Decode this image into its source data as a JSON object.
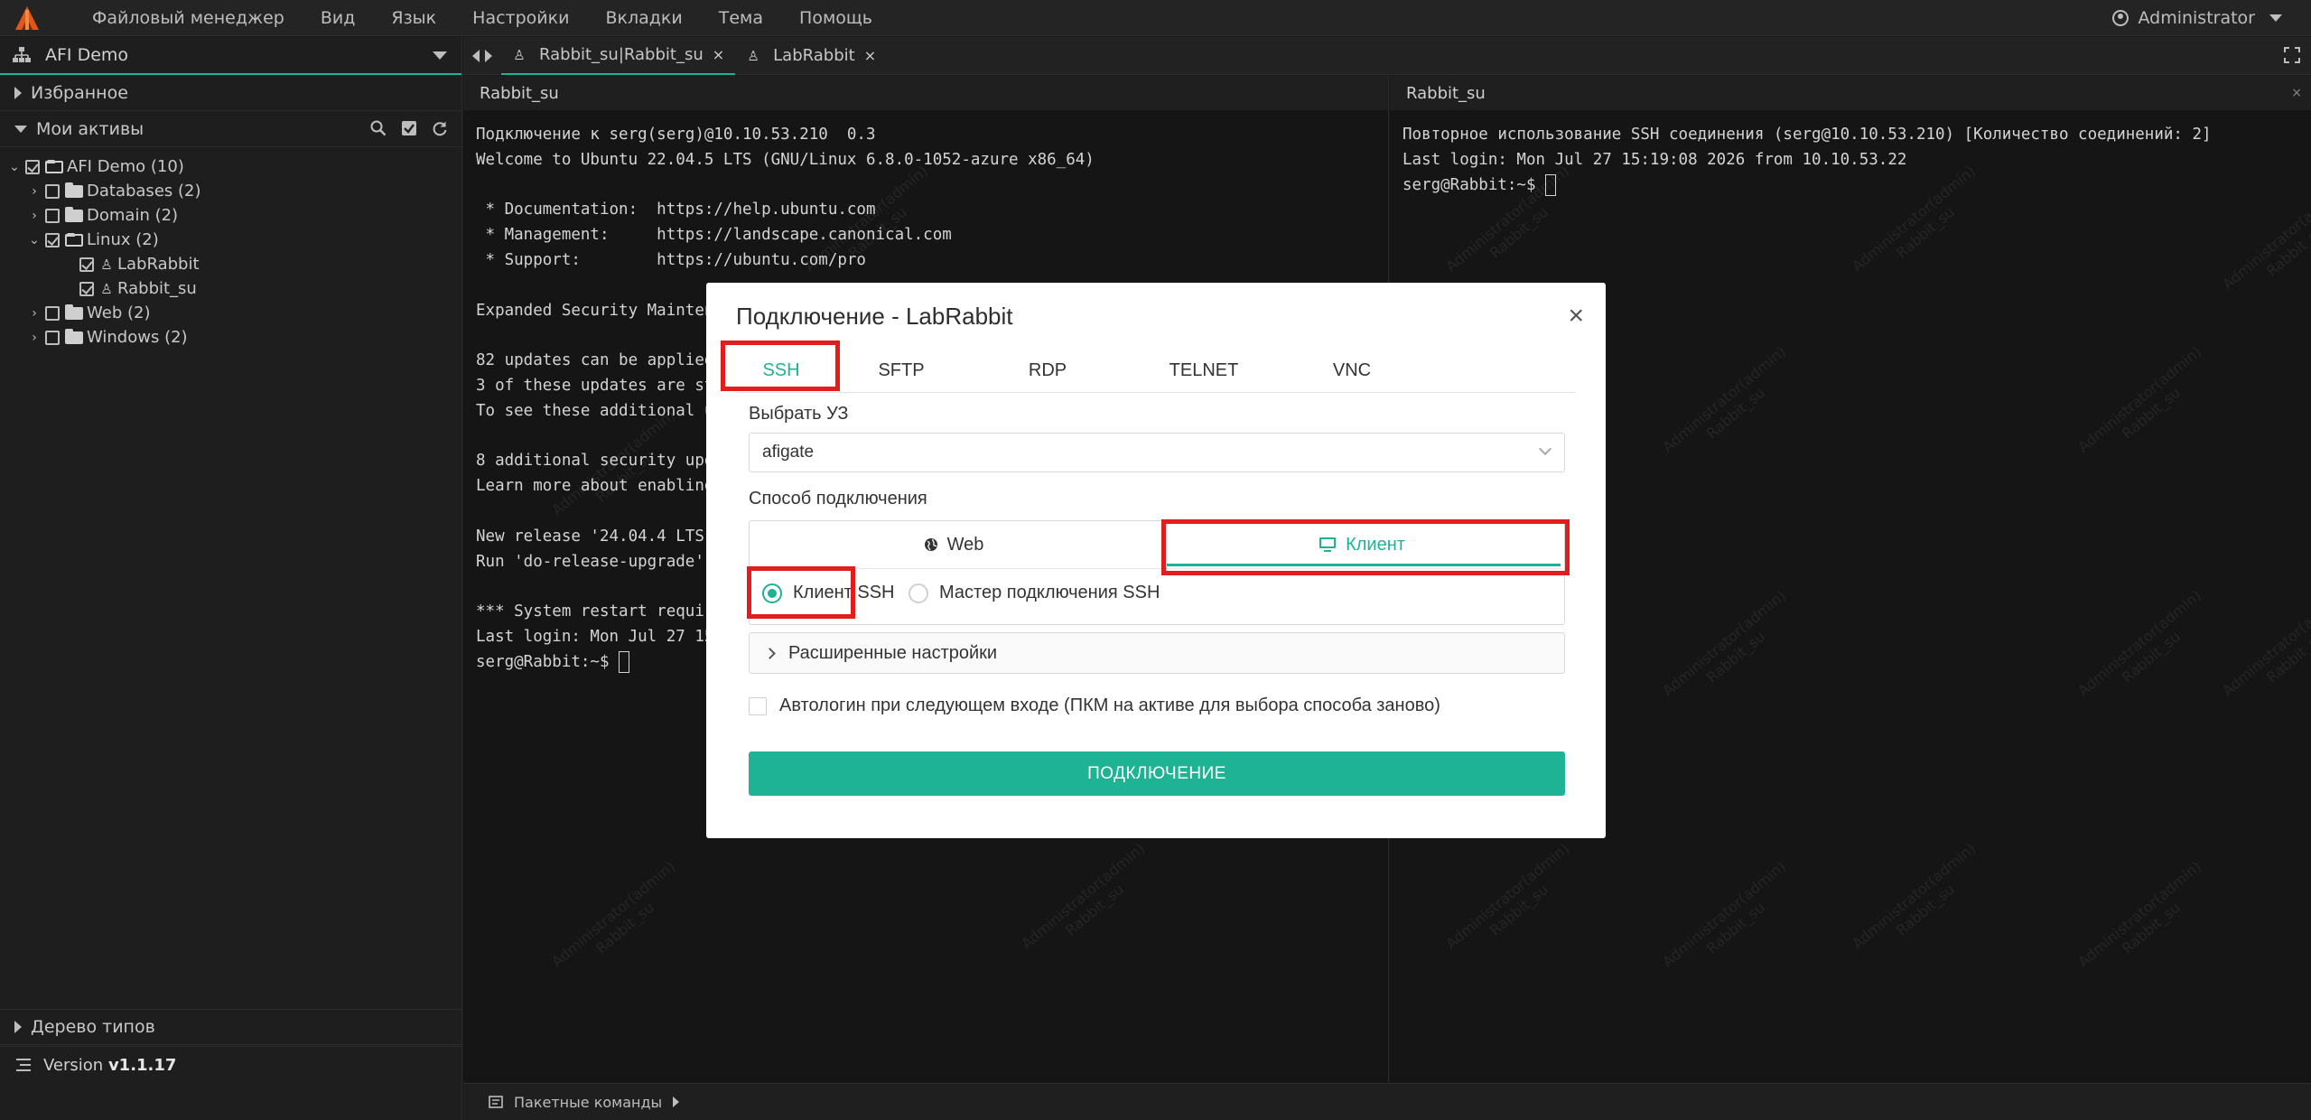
{
  "menubar": {
    "items": [
      "Файловый менеджер",
      "Вид",
      "Язык",
      "Настройки",
      "Вкладки",
      "Тема",
      "Помощь"
    ],
    "user": "Administrator"
  },
  "sidebar": {
    "selector": "AFI Demo",
    "favorites": "Избранное",
    "my_assets": "Мои активы",
    "tree": {
      "root": "AFI Demo (10)",
      "databases": "Databases (2)",
      "domain": "Domain (2)",
      "linux": "Linux (2)",
      "labrabbit": "LabRabbit",
      "rabbit_su": "Rabbit_su",
      "web": "Web (2)",
      "windows": "Windows (2)"
    },
    "type_tree": "Дерево типов",
    "version_label": "Version",
    "version_value": "v1.1.17"
  },
  "tabs": [
    {
      "label": "Rabbit_su|Rabbit_su",
      "close": "×"
    },
    {
      "label": "LabRabbit",
      "close": "×"
    }
  ],
  "pane_left": {
    "title": "Rabbit_su",
    "lines": [
      "Подключение к serg(serg)@10.10.53.210  0.3",
      "Welcome to Ubuntu 22.04.5 LTS (GNU/Linux 6.8.0-1052-azure x86_64)",
      "",
      " * Documentation:  https://help.ubuntu.com",
      " * Management:     https://landscape.canonical.com",
      " * Support:        https://ubuntu.com/pro",
      "",
      "Expanded Security Maintena",
      "",
      "82 updates can be applied",
      "3 of these updates are sta",
      "To see these additional up",
      "",
      "8 additional security upda",
      "Learn more about enabling",
      "",
      "New release '24.04.4 LTS'",
      "Run 'do-release-upgrade' t",
      "",
      "*** System restart require",
      "Last login: Mon Jul 27 15:"
    ],
    "prompt": "serg@Rabbit:~$ "
  },
  "pane_right": {
    "title": "Rabbit_su",
    "close": "×",
    "lines": [
      "Повторное использование SSH соединения (serg@10.10.53.210) [Количество соединений: 2]",
      "Last login: Mon Jul 27 15:19:08 2026 from 10.10.53.22"
    ],
    "prompt": "serg@Rabbit:~$ "
  },
  "watermark": "Administrator(admin)\nRabbit_su",
  "statusbar": {
    "label": "Пакетные команды"
  },
  "modal": {
    "title": "Подключение - LabRabbit",
    "close": "×",
    "protocols": [
      "SSH",
      "SFTP",
      "RDP",
      "TELNET",
      "VNC"
    ],
    "active_protocol": "SSH",
    "account_label": "Выбрать УЗ",
    "account_value": "afigate",
    "method_label": "Способ подключения",
    "method_web": "Web",
    "method_client": "Клиент",
    "client_ssh": "Клиент SSH",
    "ssh_wizard": "Мастер подключения SSH",
    "advanced": "Расширенные настройки",
    "autologin": "Автологин при следующем входе (ПКМ на активе для выбора способа заново)",
    "connect": "ПОДКЛЮЧЕНИЕ"
  },
  "colors": {
    "accent": "#1db394",
    "highlight": "#e11d1d",
    "logo": "#e0561b"
  }
}
